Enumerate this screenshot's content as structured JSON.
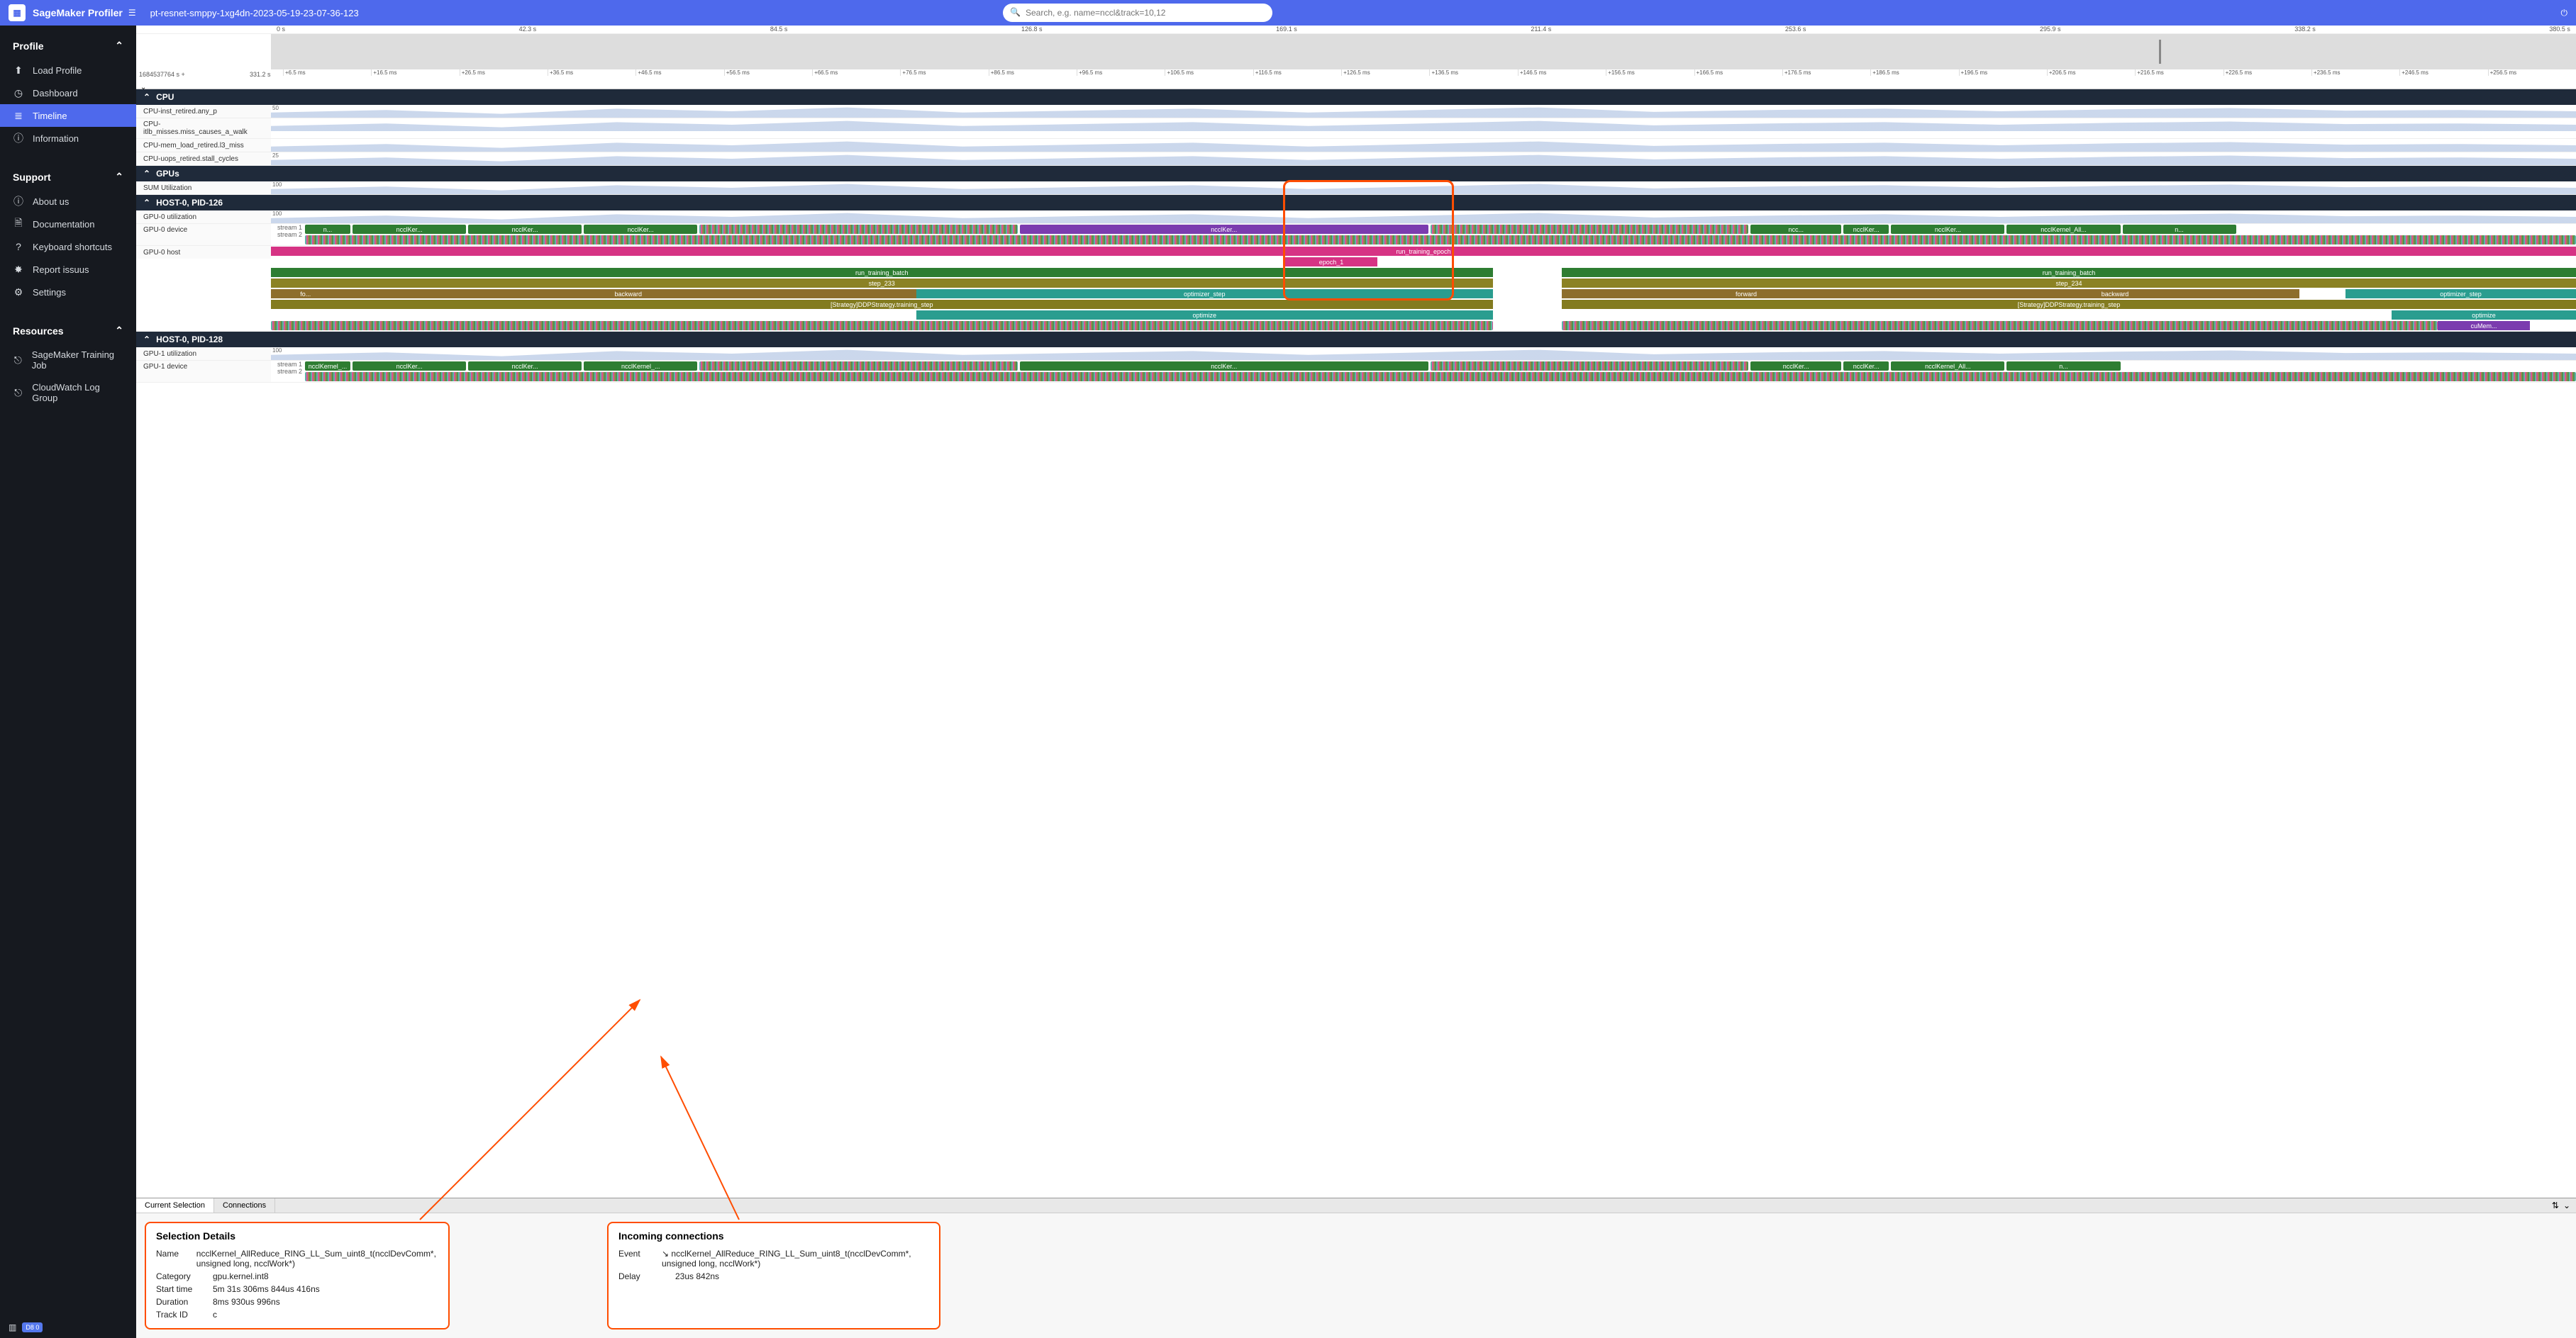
{
  "app": {
    "title": "SageMaker Profiler"
  },
  "job": {
    "name": "pt-resnet-smppy-1xg4dn-2023-05-19-23-07-36-123"
  },
  "search": {
    "placeholder": "Search, e.g. name=nccl&track=10,12"
  },
  "sidebar": {
    "sections": {
      "profile": {
        "heading": "Profile",
        "items": [
          {
            "label": "Load Profile"
          },
          {
            "label": "Dashboard"
          },
          {
            "label": "Timeline"
          },
          {
            "label": "Information"
          }
        ]
      },
      "support": {
        "heading": "Support",
        "items": [
          {
            "label": "About us"
          },
          {
            "label": "Documentation"
          },
          {
            "label": "Keyboard shortcuts"
          },
          {
            "label": "Report issuus"
          },
          {
            "label": "Settings"
          }
        ]
      },
      "resources": {
        "heading": "Resources",
        "items": [
          {
            "label": "SageMaker Training Job"
          },
          {
            "label": "CloudWatch Log Group"
          }
        ]
      }
    },
    "footer_badge": "D8 0"
  },
  "ruler": {
    "top_ticks": [
      "0 s",
      "42.3 s",
      "84.5 s",
      "126.8 s",
      "169.1 s",
      "211.4 s",
      "253.6 s",
      "295.9 s",
      "338.2 s",
      "380.5 s"
    ],
    "anchor": "1684537764 s +",
    "anchor2": "331.2 s",
    "ms_ticks": [
      "+6.5 ms",
      "+16.5 ms",
      "+26.5 ms",
      "+36.5 ms",
      "+46.5 ms",
      "+56.5 ms",
      "+66.5 ms",
      "+76.5 ms",
      "+86.5 ms",
      "+96.5 ms",
      "+106.5 ms",
      "+116.5 ms",
      "+126.5 ms",
      "+136.5 ms",
      "+146.5 ms",
      "+156.5 ms",
      "+166.5 ms",
      "+176.5 ms",
      "+186.5 ms",
      "+196.5 ms",
      "+206.5 ms",
      "+216.5 ms",
      "+226.5 ms",
      "+236.5 ms",
      "+246.5 ms",
      "+256.5 ms"
    ]
  },
  "tracks": {
    "cpu": {
      "header": "CPU",
      "rows": [
        {
          "label": "CPU-inst_retired.any_p",
          "scale": "50"
        },
        {
          "label": "CPU-itlb_misses.miss_causes_a_walk"
        },
        {
          "label": "CPU-mem_load_retired.l3_miss"
        },
        {
          "label": "CPU-uops_retired.stall_cycles",
          "scale": "25"
        }
      ]
    },
    "gpus": {
      "header": "GPUs",
      "sum": {
        "label": "SUM Utilization",
        "scale": "100"
      }
    },
    "host0_126": {
      "header": "HOST-0, PID-126",
      "util": {
        "label": "GPU-0 utilization",
        "scale": "100"
      },
      "device": {
        "label": "GPU-0 device",
        "streams": [
          "stream 1",
          "stream 2"
        ]
      },
      "kernel_names": [
        "n...",
        "ncclKer...",
        "ncclKer...",
        "ncclKer...",
        "ncclKer...",
        "ncc...",
        "ncclKer...",
        "ncclKer...",
        "ncclKernel_All...",
        "n..."
      ],
      "host_label": "GPU-0 host",
      "host_rows": {
        "epoch": "run_training_epoch",
        "epoch1": "epoch_1",
        "batch_l": "run_training_batch",
        "batch_r": "run_training_batch",
        "step_l": "step_233",
        "step_r": "step_234",
        "fo": "fo...",
        "backward_l": "backward",
        "optstep_l": "optimizer_step",
        "forward": "forward",
        "backward_r": "backward",
        "optstep_r": "optimizer_step",
        "strategy_l": "[Strategy]DDPStrategy.training_step",
        "strategy_r": "[Strategy]DDPStrategy.training_step",
        "optimize_l": "optimize",
        "optimize_r": "optimize",
        "cumem": "cuMem..."
      }
    },
    "host0_128": {
      "header": "HOST-0, PID-128",
      "util": {
        "label": "GPU-1 utilization",
        "scale": "100"
      },
      "device": {
        "label": "GPU-1 device",
        "streams": [
          "stream 1",
          "stream 2"
        ]
      },
      "kernel_names": [
        "ncclKernel_...",
        "ncclKer...",
        "ncclKer...",
        "ncclKernel_...",
        "ncclKer...",
        "ncclKer...",
        "ncclKer...",
        "ncclKernel_All...",
        "n..."
      ]
    }
  },
  "bottom": {
    "tabs": [
      "Current Selection",
      "Connections"
    ],
    "selection": {
      "title": "Selection Details",
      "rows": [
        {
          "k": "Name",
          "v": "ncclKernel_AllReduce_RING_LL_Sum_uint8_t(ncclDevComm*, unsigned long, ncclWork*)"
        },
        {
          "k": "Category",
          "v": "gpu.kernel.int8"
        },
        {
          "k": "Start time",
          "v": "5m 31s 306ms 844us 416ns"
        },
        {
          "k": "Duration",
          "v": "8ms 930us 996ns"
        },
        {
          "k": "Track ID",
          "v": "c"
        }
      ]
    },
    "incoming": {
      "title": "Incoming connections",
      "rows": [
        {
          "k": "Event",
          "v": "↘ ncclKernel_AllReduce_RING_LL_Sum_uint8_t(ncclDevComm*, unsigned long, ncclWork*)"
        },
        {
          "k": "Delay",
          "v": "23us 842ns"
        }
      ]
    }
  }
}
